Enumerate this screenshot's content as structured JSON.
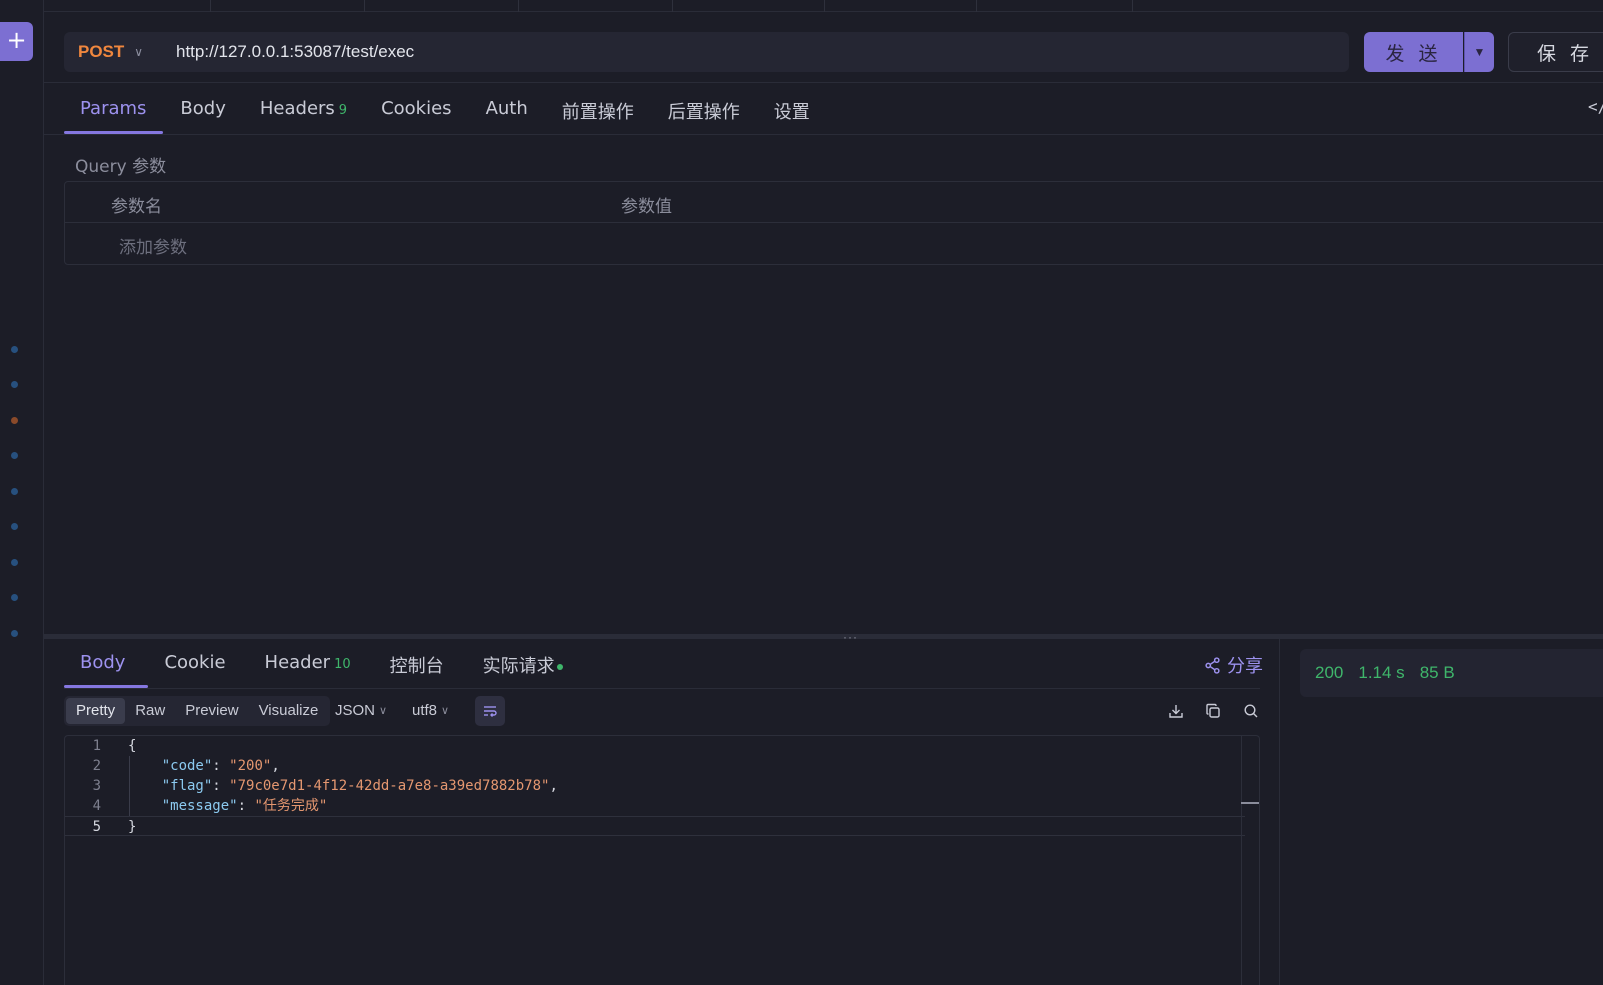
{
  "request": {
    "method": "POST",
    "url": "http://127.0.0.1:53087/test/exec",
    "send_label": "发 送",
    "save_label": "保 存"
  },
  "request_tabs": [
    {
      "label": "Params",
      "active": true
    },
    {
      "label": "Body"
    },
    {
      "label": "Headers",
      "badge": "9"
    },
    {
      "label": "Cookies"
    },
    {
      "label": "Auth"
    },
    {
      "label": "前置操作"
    },
    {
      "label": "后置操作"
    },
    {
      "label": "设置"
    }
  ],
  "query": {
    "title": "Query 参数",
    "col_name": "参数名",
    "col_value": "参数值",
    "add_placeholder": "添加参数"
  },
  "response_tabs": [
    {
      "label": "Body",
      "active": true
    },
    {
      "label": "Cookie"
    },
    {
      "label": "Header",
      "badge": "10"
    },
    {
      "label": "控制台"
    },
    {
      "label": "实际请求",
      "dot": true
    }
  ],
  "share_label": "分享",
  "format": {
    "modes": [
      "Pretty",
      "Raw",
      "Preview",
      "Visualize"
    ],
    "active_mode": "Pretty",
    "language": "JSON",
    "encoding": "utf8"
  },
  "response_body": {
    "line_numbers": [
      "1",
      "2",
      "3",
      "4",
      "5"
    ],
    "open_brace": "{",
    "close_brace": "}",
    "fields": [
      {
        "key": "\"code\"",
        "value": "\"200\"",
        "comma": ","
      },
      {
        "key": "\"flag\"",
        "value": "\"79c0e7d1-4f12-42dd-a7e8-a39ed7882b78\"",
        "comma": ","
      },
      {
        "key": "\"message\"",
        "value": "\"任务完成\"",
        "comma": ""
      }
    ]
  },
  "status": {
    "code": "200",
    "time": "1.14 s",
    "size": "85 B"
  },
  "colors": {
    "accent": "#7c6fd2",
    "method": "#f0873e",
    "success": "#3fb66b"
  }
}
